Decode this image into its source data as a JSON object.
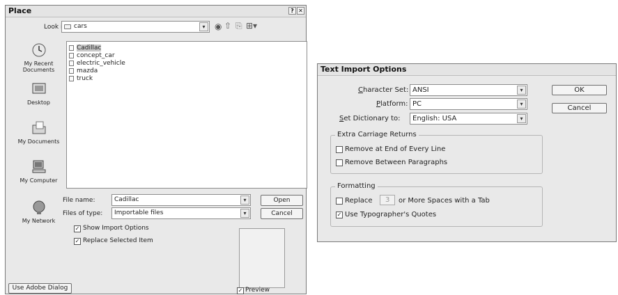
{
  "place": {
    "title": "Place",
    "lookin_label": "Look in:",
    "lookin_value": "cars",
    "sidebar": [
      {
        "label": "My Recent Documents",
        "icon": "recent-documents-icon"
      },
      {
        "label": "Desktop",
        "icon": "desktop-icon"
      },
      {
        "label": "My Documents",
        "icon": "my-documents-icon"
      },
      {
        "label": "My Computer",
        "icon": "my-computer-icon"
      },
      {
        "label": "My Network",
        "icon": "my-network-icon"
      }
    ],
    "files": [
      "Cadillac",
      "concept_car",
      "electric_vehicle",
      "mazda",
      "truck"
    ],
    "filename_label": "File name:",
    "filename_value": "Cadillac",
    "filetype_label": "Files of type:",
    "filetype_value": "Importable files",
    "open_label": "Open",
    "cancel_label": "Cancel",
    "show_import": "Show Import Options",
    "replace_selected": "Replace Selected Item",
    "use_adobe": "Use Adobe Dialog",
    "preview": "Preview"
  },
  "tio": {
    "title": "Text Import Options",
    "charset_label_pre": "",
    "charset_label_u": "C",
    "charset_label_post": "haracter Set:",
    "charset_value": "ANSI",
    "platform_label_u": "P",
    "platform_label_post": "latform:",
    "platform_value": "PC",
    "dict_label_u": "S",
    "dict_label_post": "et Dictionary to:",
    "dict_value": "English: USA",
    "ok_label": "OK",
    "cancel_label": "Cancel",
    "extra_title": "Extra Carriage Returns",
    "remove_end": "Remove at End of Every Line",
    "remove_between": "Remove Between Paragraphs",
    "formatting_title": "Formatting",
    "replace_label": "Replace",
    "spaces_value": "3",
    "spaces_suffix": "or More Spaces with a Tab",
    "typographer": "Use Typographer's Quotes"
  }
}
